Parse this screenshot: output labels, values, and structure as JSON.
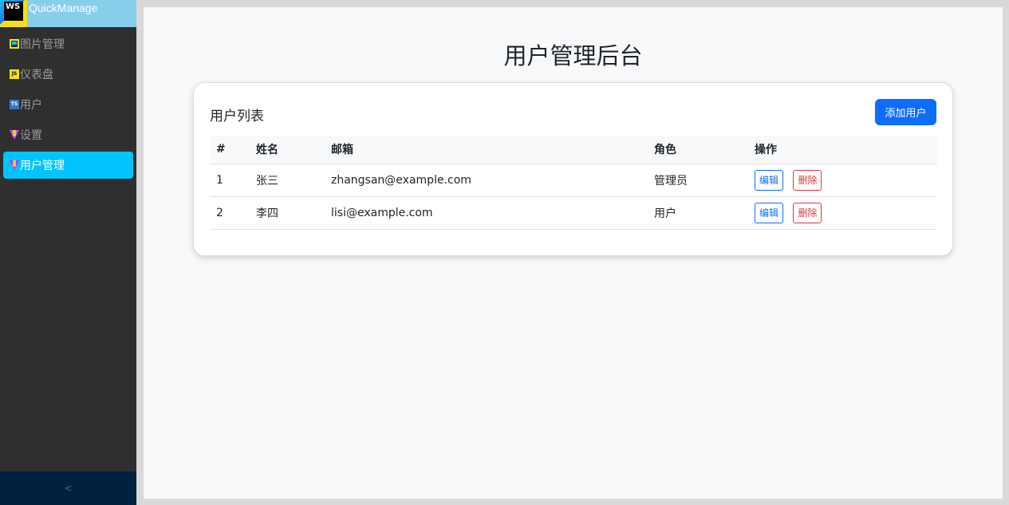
{
  "app": {
    "logo_text": "WS",
    "title": "QuickManage"
  },
  "sidebar": {
    "items": [
      {
        "label": "图片管理",
        "icon": "image-icon"
      },
      {
        "label": "仪表盘",
        "icon": "js-icon"
      },
      {
        "label": "用户",
        "icon": "ts-icon"
      },
      {
        "label": "设置",
        "icon": "vite-icon"
      },
      {
        "label": "用户管理",
        "icon": "vite-icon",
        "active": true
      }
    ],
    "collapse_label": "<"
  },
  "main": {
    "page_title": "用户管理后台",
    "card": {
      "title": "用户列表",
      "add_button_label": "添加用户"
    },
    "table": {
      "headers": [
        "#",
        "姓名",
        "邮箱",
        "角色",
        "操作"
      ],
      "rows": [
        {
          "id": "1",
          "name": "张三",
          "email": "zhangsan@example.com",
          "role": "管理员",
          "edit_label": "编辑",
          "delete_label": "删除"
        },
        {
          "id": "2",
          "name": "李四",
          "email": "lisi@example.com",
          "role": "用户",
          "edit_label": "编辑",
          "delete_label": "删除"
        }
      ]
    }
  },
  "colors": {
    "brand_bar": "#87ceeb",
    "sidebar_bg": "#2f2f2f",
    "active_item": "#00c3ff",
    "primary": "#0d6efd",
    "danger": "#dc3545"
  }
}
